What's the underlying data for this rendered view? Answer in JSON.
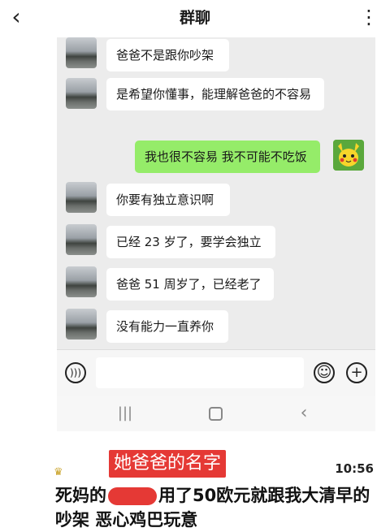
{
  "header": {
    "back_icon": "chevron-left-icon",
    "title": "群聊",
    "more_icon": "more-vertical-icon"
  },
  "messages": [
    {
      "sender": "other",
      "text": "爸爸不是跟你吵架"
    },
    {
      "sender": "other",
      "text": "是希望你懂事，能理解爸爸的不容易"
    },
    {
      "sender": "me",
      "text": "我也很不容易 我不可能不吃饭"
    },
    {
      "sender": "other",
      "text": "你要有独立意识啊"
    },
    {
      "sender": "other",
      "text": "已经 23 岁了，要学会独立"
    },
    {
      "sender": "other",
      "text": "爸爸 51 周岁了，已经老了"
    },
    {
      "sender": "other",
      "text": "没有能力一直养你"
    }
  ],
  "input_bar": {
    "voice_icon": "voice-icon",
    "emoji_icon": "emoji-icon",
    "plus_icon": "plus-icon"
  },
  "nav_bar": {
    "recents_icon": "recents-icon",
    "home_icon": "home-icon",
    "back_icon": "back-icon"
  },
  "post": {
    "annotation_tag": "她爸爸的名字",
    "time": "10:56",
    "text_part1": "死妈的",
    "text_part2": "用了50欧元就跟我大清早的吵架 恶心鸡巴玩意"
  },
  "colors": {
    "chat_bg": "#ececec",
    "my_bubble": "#95ec69",
    "tag_red": "#e53935"
  }
}
